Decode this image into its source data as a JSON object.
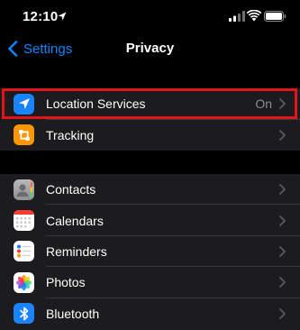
{
  "status_bar": {
    "time": "12:10"
  },
  "nav": {
    "back_label": "Settings",
    "title": "Privacy"
  },
  "group_1": [
    {
      "label": "Location Services",
      "value": "On",
      "icon": "location-arrow-icon",
      "color": "#1a84ff"
    },
    {
      "label": "Tracking",
      "value": "",
      "icon": "tracking-icon",
      "color": "#ff9500"
    }
  ],
  "group_2": [
    {
      "label": "Contacts",
      "icon": "contacts-icon",
      "color": "#a5a5aa"
    },
    {
      "label": "Calendars",
      "icon": "calendar-icon",
      "color": "#ffffff"
    },
    {
      "label": "Reminders",
      "icon": "reminders-icon",
      "color": "#ffffff"
    },
    {
      "label": "Photos",
      "icon": "photos-icon",
      "color": "#ffffff"
    },
    {
      "label": "Bluetooth",
      "icon": "bluetooth-icon",
      "color": "#1a84ff"
    }
  ],
  "colors": {
    "accent": "#0a84ff",
    "highlight": "#e3151a",
    "background": "#000000",
    "cell": "#1c1c1e"
  }
}
